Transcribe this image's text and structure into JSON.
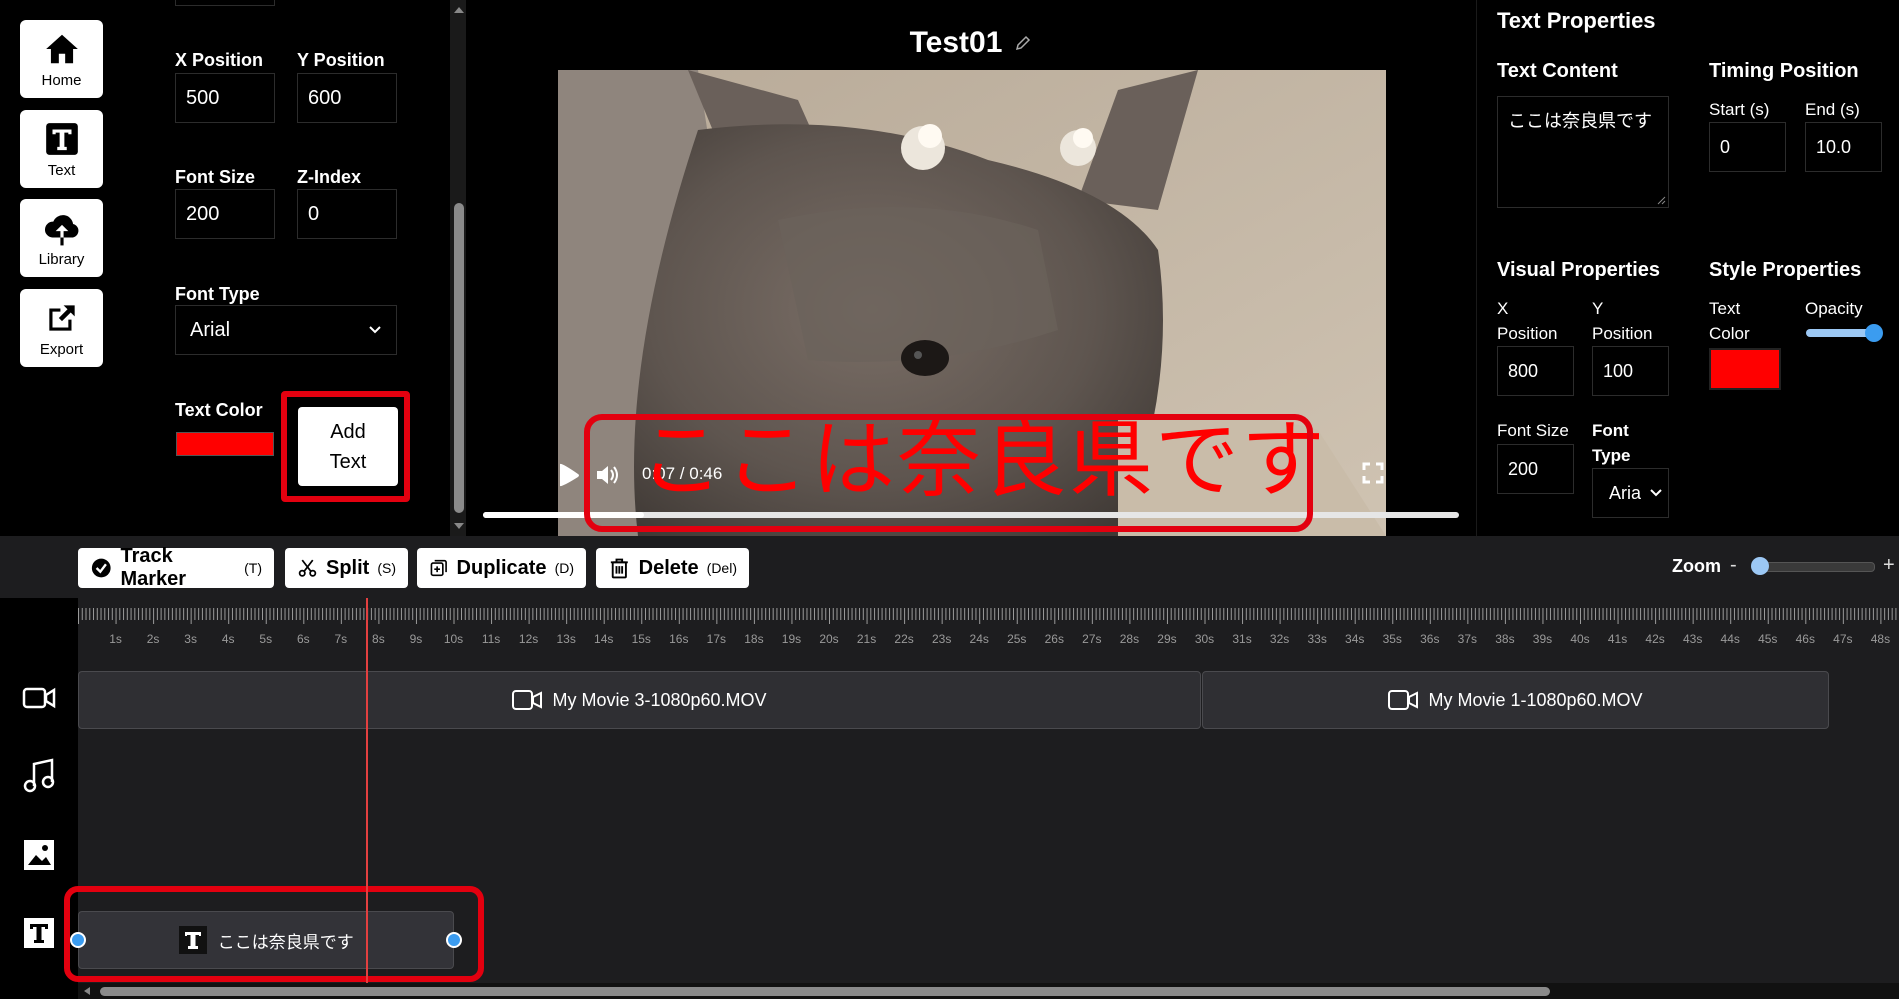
{
  "sidebar": {
    "items": [
      {
        "label": "Home",
        "icon": "home-icon"
      },
      {
        "label": "Text",
        "icon": "text-icon"
      },
      {
        "label": "Library",
        "icon": "cloud-upload-icon"
      },
      {
        "label": "Export",
        "icon": "export-icon"
      }
    ]
  },
  "text_form": {
    "x_position_label": "X Position",
    "x_position_value": "500",
    "y_position_label": "Y Position",
    "y_position_value": "600",
    "font_size_label": "Font Size",
    "font_size_value": "200",
    "z_index_label": "Z-Index",
    "z_index_value": "0",
    "font_type_label": "Font Type",
    "font_type_value": "Arial",
    "text_color_label": "Text Color",
    "text_color_value": "#ff0000",
    "add_text_line1": "Add",
    "add_text_line2": "Text"
  },
  "preview": {
    "title": "Test01",
    "overlay_text": "ここは奈良県です",
    "time_display": "0:07 / 0:46",
    "progress_fraction": 0.165
  },
  "text_properties": {
    "heading": "Text Properties",
    "content_label": "Text Content",
    "content_value": "ここは奈良県です",
    "timing_label": "Timing Position",
    "start_label": "Start (s)",
    "start_value": "0",
    "end_label": "End (s)",
    "end_value": "10.0",
    "visual_label": "Visual Properties",
    "x_label_1": "X",
    "x_label_2": "Position",
    "x_value": "800",
    "y_label_1": "Y",
    "y_label_2": "Position",
    "y_value": "100",
    "font_size_label": "Font Size",
    "font_size_value": "200",
    "font_type_label_1": "Font",
    "font_type_label_2": "Type",
    "font_type_value": "Arial",
    "style_label": "Style Properties",
    "text_color_label_1": "Text",
    "text_color_label_2": "Color",
    "text_color_value": "#ff0000",
    "opacity_label": "Opacity",
    "opacity_value": 1.0
  },
  "toolbar": {
    "track_marker_label": "Track Marker",
    "track_marker_key": "(T)",
    "split_label": "Split",
    "split_key": "(S)",
    "duplicate_label": "Duplicate",
    "duplicate_key": "(D)",
    "delete_label": "Delete",
    "delete_key": "(Del)",
    "zoom_label": "Zoom",
    "zoom_minus": "-",
    "zoom_plus": "+",
    "zoom_fraction": 0.0
  },
  "timeline": {
    "ticks": [
      "1s",
      "2s",
      "3s",
      "4s",
      "5s",
      "6s",
      "7s",
      "8s",
      "9s",
      "10s",
      "11s",
      "12s",
      "13s",
      "14s",
      "15s",
      "16s",
      "17s",
      "18s",
      "19s",
      "20s",
      "21s",
      "22s",
      "23s",
      "24s",
      "25s",
      "26s",
      "27s",
      "28s",
      "29s",
      "30s",
      "31s",
      "32s",
      "33s",
      "34s",
      "35s",
      "36s",
      "37s",
      "38s",
      "39s",
      "40s",
      "41s",
      "42s",
      "43s",
      "44s",
      "45s",
      "46s",
      "47s",
      "48s"
    ],
    "playhead_seconds": 7.7,
    "video_clips": [
      {
        "name": "My Movie 3-1080p60.MOV"
      },
      {
        "name": "My Movie 1-1080p60.MOV"
      }
    ],
    "text_clip": {
      "name": "ここは奈良県です"
    },
    "track_icons": [
      "video-track-icon",
      "audio-track-icon",
      "image-track-icon",
      "text-track-icon"
    ]
  },
  "colors": {
    "accent": "#3b9cf0",
    "highlight_red": "#e3000f",
    "text_red": "#ff0000",
    "panel_bg": "#000000",
    "timeline_bg": "#1d1d1f"
  }
}
